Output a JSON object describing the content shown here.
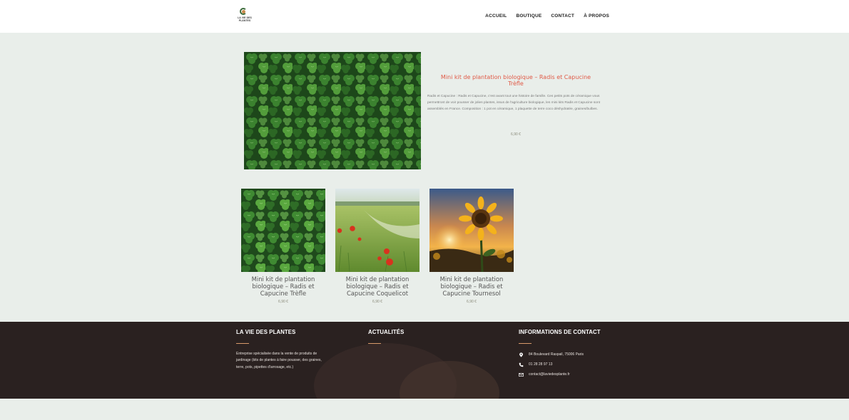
{
  "brand": {
    "logo_line1": "LA VIE DES",
    "logo_line2": "PLANTES"
  },
  "nav": {
    "items": [
      "ACCUEIL",
      "BOUTIQUE",
      "CONTACT",
      "À PROPOS"
    ]
  },
  "featured": {
    "title": "Mini kit de plantation biologique – Radis et Capucine Trèfle",
    "description": "Radis et Capucine : Radis et Capucine, c'est avant tout une histoire de famille. Ces petits pots de céramique vous permettront de voir pousser de jolies plantes, issus de l'agriculture biologique, les mini kits Radis et Capucine sont assemblés en France. Composition : 1 pot en céramique, 1 plaquette de terre coco déshydratée, graines/bulbes.",
    "price": "6,90 €"
  },
  "products": [
    {
      "title": "Mini kit de plantation biologique – Radis et Capucine Trèfle",
      "price": "6,90 €",
      "image": "clover"
    },
    {
      "title": "Mini kit de plantation biologique – Radis et Capucine Coquelicot",
      "price": "6,90 €",
      "image": "poppy-field"
    },
    {
      "title": "Mini kit de plantation biologique – Radis et Capucine Tournesol",
      "price": "6,90 €",
      "image": "sunflower"
    }
  ],
  "footer": {
    "about_heading": "LA VIE DES PLANTES",
    "about_text": "Entreprise spécialisée dans la vente de produits de jardinage (kits de plantes à faire pousser, des graines, terre, pots, pipettes d'arrosage, etc.)",
    "news_heading": "ACTUALITÉS",
    "contact_heading": "INFORMATIONS DE CONTACT",
    "address": "84 Boulevard Raspail, 75006 Paris",
    "phone": "01 28 28 97 13",
    "email": "contact@laviedesplante.fr"
  },
  "colors": {
    "accent": "#e05a47",
    "footer_bg": "#2a2120",
    "page_bg": "#e9eeea",
    "footer_line": "#d89a6a"
  }
}
